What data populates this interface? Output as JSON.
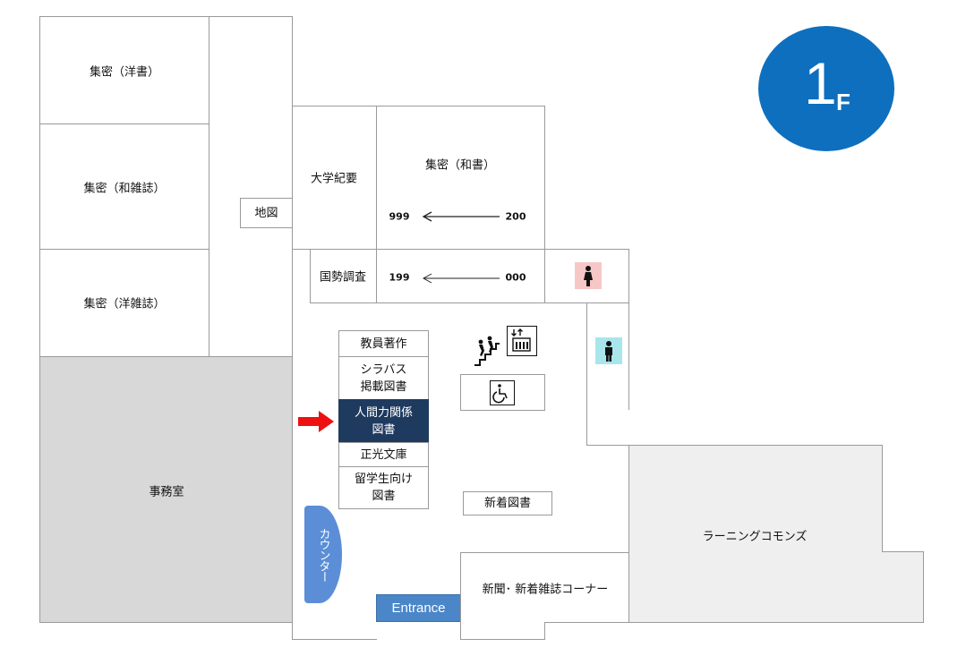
{
  "floor": {
    "number": "1",
    "unit": "F"
  },
  "rooms": {
    "yosho": "集密（洋書）",
    "wazasshi": "集密（和雑誌）",
    "yozasshi": "集密（洋雑誌）",
    "jimushitsu": "事務室",
    "chizu": "地図",
    "daigaku_kiyo": "大学紀要",
    "washo": "集密（和書）",
    "kokusei": "国勢調査",
    "learning_commons": "ラーニングコモンズ",
    "shinbun": "新聞･ 新着雑誌コーナー",
    "shinchaku": "新着図書",
    "counter": "カウンター",
    "entrance": "Entrance"
  },
  "shelf_numbers": {
    "row1_left": "999",
    "row1_right": "200",
    "row2_left": "199",
    "row2_right": "000"
  },
  "shelves": [
    "教員著作",
    "シラバス\n掲載図書",
    "人間力関係\n図書",
    "正光文庫",
    "留学生向け\n図書"
  ],
  "highlighted_shelf_index": 2,
  "icons": {
    "women_restroom": "women-restroom-icon",
    "men_restroom": "men-restroom-icon",
    "stairs": "stairs-icon",
    "elevator": "elevator-icon",
    "accessible": "wheelchair-icon",
    "arrow": "red-arrow-icon"
  },
  "colors": {
    "badge": "#0e6fbf",
    "office": "#d8d8d8",
    "commons": "#efefef",
    "highlight": "#1f3a5f",
    "counter": "#5b8ed6",
    "entrance": "#4b86c8",
    "women": "#f7c6c6",
    "men": "#a8e6ec",
    "arrow": "#ee1111"
  }
}
